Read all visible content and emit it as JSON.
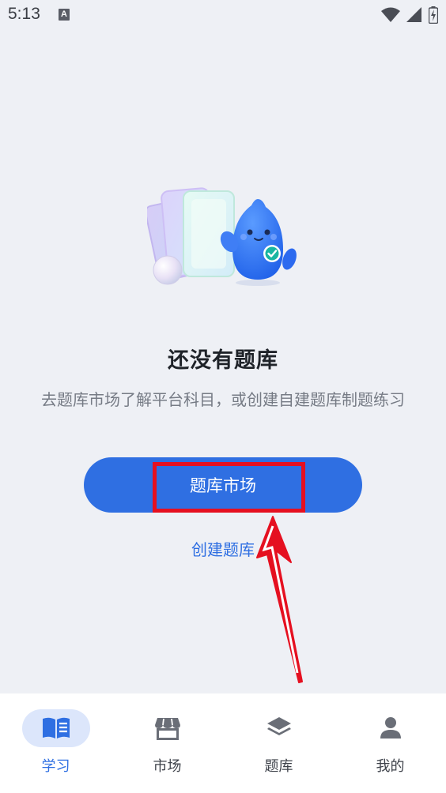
{
  "status_bar": {
    "time": "5:13",
    "notification_icon_letter": "A"
  },
  "empty_state": {
    "title": "还没有题库",
    "description": "去题库市场了解平台科目，或创建自建题库制题练习",
    "primary_button": "题库市场",
    "secondary_link": "创建题库"
  },
  "colors": {
    "accent": "#2f6fe2",
    "annotation": "#e51020",
    "background": "#eef0f5"
  },
  "bottom_nav": {
    "items": [
      {
        "label": "学习",
        "icon": "book-icon",
        "active": true
      },
      {
        "label": "市场",
        "icon": "store-icon",
        "active": false
      },
      {
        "label": "题库",
        "icon": "layers-icon",
        "active": false
      },
      {
        "label": "我的",
        "icon": "person-icon",
        "active": false
      }
    ]
  }
}
